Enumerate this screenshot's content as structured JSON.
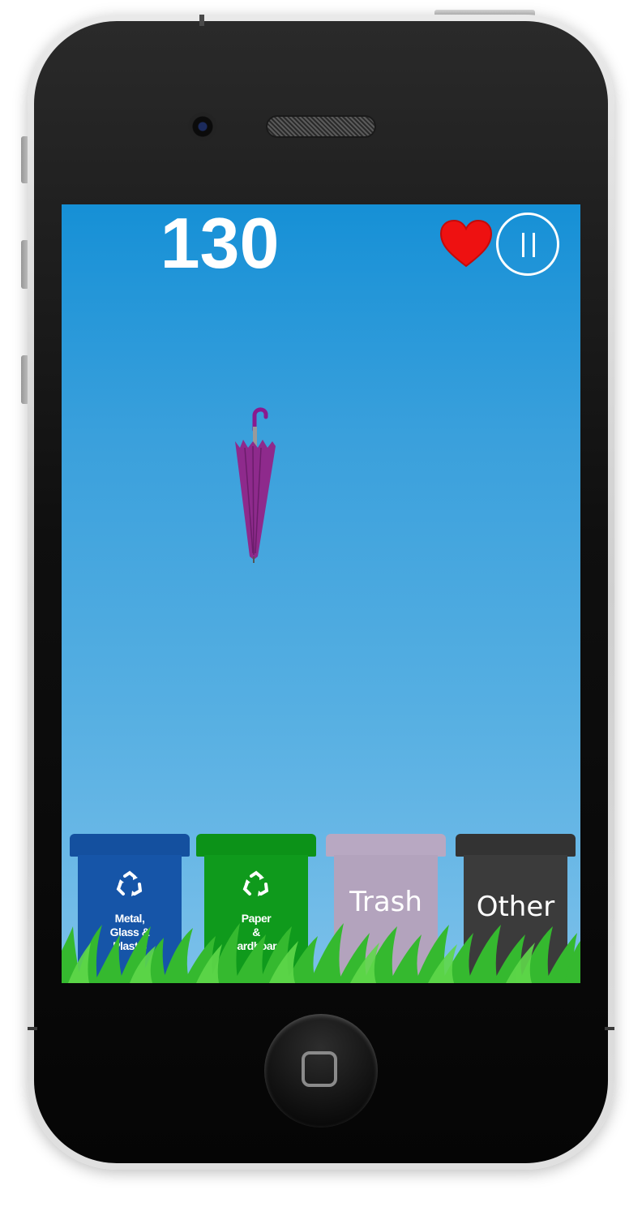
{
  "game": {
    "score": "130",
    "lives": 1,
    "falling_item": "umbrella-icon",
    "bins": [
      {
        "lines": [
          "Metal,",
          "Glass &",
          "Plastic"
        ],
        "color": "#1655a8",
        "icon": "recycle-icon"
      },
      {
        "lines": [
          "Paper",
          "&",
          "Cardboard"
        ],
        "color": "#0f9a1c",
        "icon": "recycle-icon"
      },
      {
        "lines": [
          "Trash"
        ],
        "color": "#b3a3bd"
      },
      {
        "lines": [
          "Other"
        ],
        "color": "#3b3b3b"
      }
    ]
  },
  "colors": {
    "sky_top": "#1690d6",
    "sky_bottom": "#7bc0ea",
    "heart": "#ee1111",
    "umbrella": "#8e2a8c",
    "grass": "#35b92f"
  }
}
